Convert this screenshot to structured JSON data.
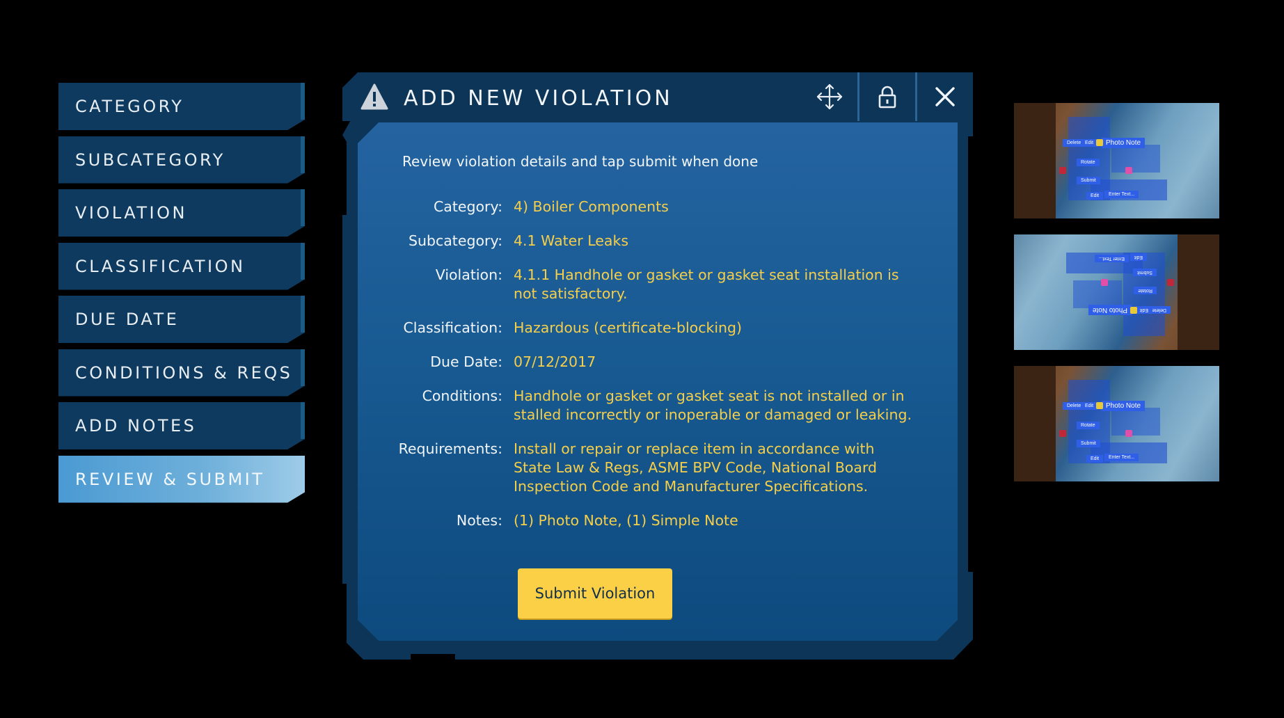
{
  "steps": [
    {
      "label": "CATEGORY",
      "active": false
    },
    {
      "label": "SUBCATEGORY",
      "active": false
    },
    {
      "label": "VIOLATION",
      "active": false
    },
    {
      "label": "CLASSIFICATION",
      "active": false
    },
    {
      "label": "DUE DATE",
      "active": false
    },
    {
      "label": "CONDITIONS & REQS",
      "active": false
    },
    {
      "label": "ADD NOTES",
      "active": false
    },
    {
      "label": "REVIEW & SUBMIT",
      "active": true
    }
  ],
  "dialog": {
    "title": "ADD NEW VIOLATION",
    "icons": {
      "title": "warning-icon",
      "move": "move-icon",
      "lock": "lock-icon",
      "close": "close-icon"
    },
    "subtitle": "Review violation details and tap submit when done",
    "fields": [
      {
        "label": "Category:",
        "value": "4) Boiler Components"
      },
      {
        "label": "Subcategory:",
        "value": "4.1 Water Leaks"
      },
      {
        "label": "Violation:",
        "value": "4.1.1 Handhole or gasket or gasket seat installation is not satisfactory."
      },
      {
        "label": "Classification:",
        "value": "Hazardous (certificate-blocking)"
      },
      {
        "label": "Due Date:",
        "value": "07/12/2017"
      },
      {
        "label": "Conditions:",
        "value": "Handhole or gasket or gasket seat is not installed or in stalled incorrectly or inoperable or damaged or leaking."
      },
      {
        "label": "Requirements:",
        "value": "Install or repair or replace item in accordance with State Law & Regs, ASME BPV Code, National Board Inspection Code and Manufacturer Specifications."
      },
      {
        "label": "Notes:",
        "value": "(1) Photo Note, (1) Simple Note"
      }
    ],
    "submit_label": "Submit Violation"
  },
  "thumbnails": {
    "photo_note_label": "Photo Note",
    "labels": [
      "Delete",
      "Edit",
      "Rotate",
      "Submit",
      "Enter Text...",
      "Edit"
    ]
  },
  "colors": {
    "background": "#000000",
    "step_bg": "#0d3a5e",
    "step_active": "#5fa6d8",
    "panel": "#185a92",
    "frame": "#0c3558",
    "value_text": "#f6cf4a",
    "button": "#fbd046"
  }
}
